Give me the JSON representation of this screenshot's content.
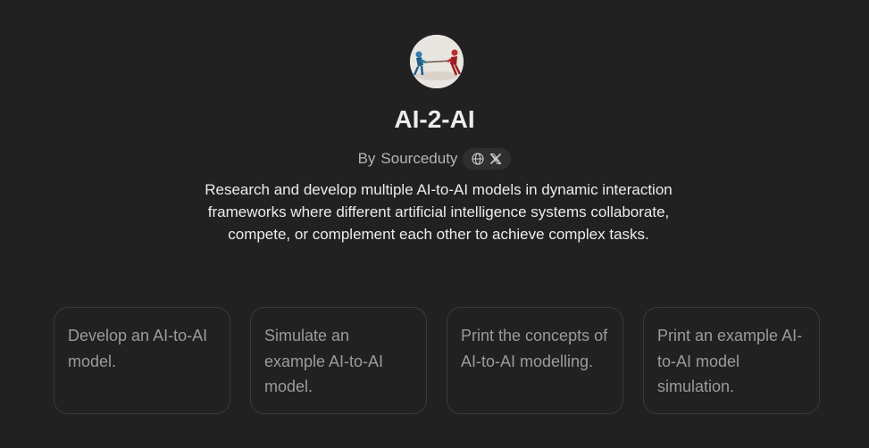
{
  "gpt": {
    "avatar_icon": "tug-of-war-robots-image",
    "title": "AI-2-AI",
    "byline_prefix": "By",
    "author": "Sourceduty",
    "social_icons": [
      "globe-icon",
      "x-logo-icon"
    ],
    "description": "Research and develop multiple AI-to-AI models in dynamic interaction frameworks where different artificial intelligence systems collaborate, compete, or complement each other to achieve complex tasks."
  },
  "starters": [
    {
      "text": "Develop an AI-to-AI model."
    },
    {
      "text": "Simulate an example AI-to-AI model."
    },
    {
      "text": "Print the concepts of AI-to-AI modelling."
    },
    {
      "text": "Print an example AI-to-AI model simulation."
    }
  ],
  "colors": {
    "background": "#212121",
    "text": "#ececec",
    "muted": "#b4b4b4",
    "card_border": "#3a3a3a",
    "card_text": "#9b9b9b"
  }
}
